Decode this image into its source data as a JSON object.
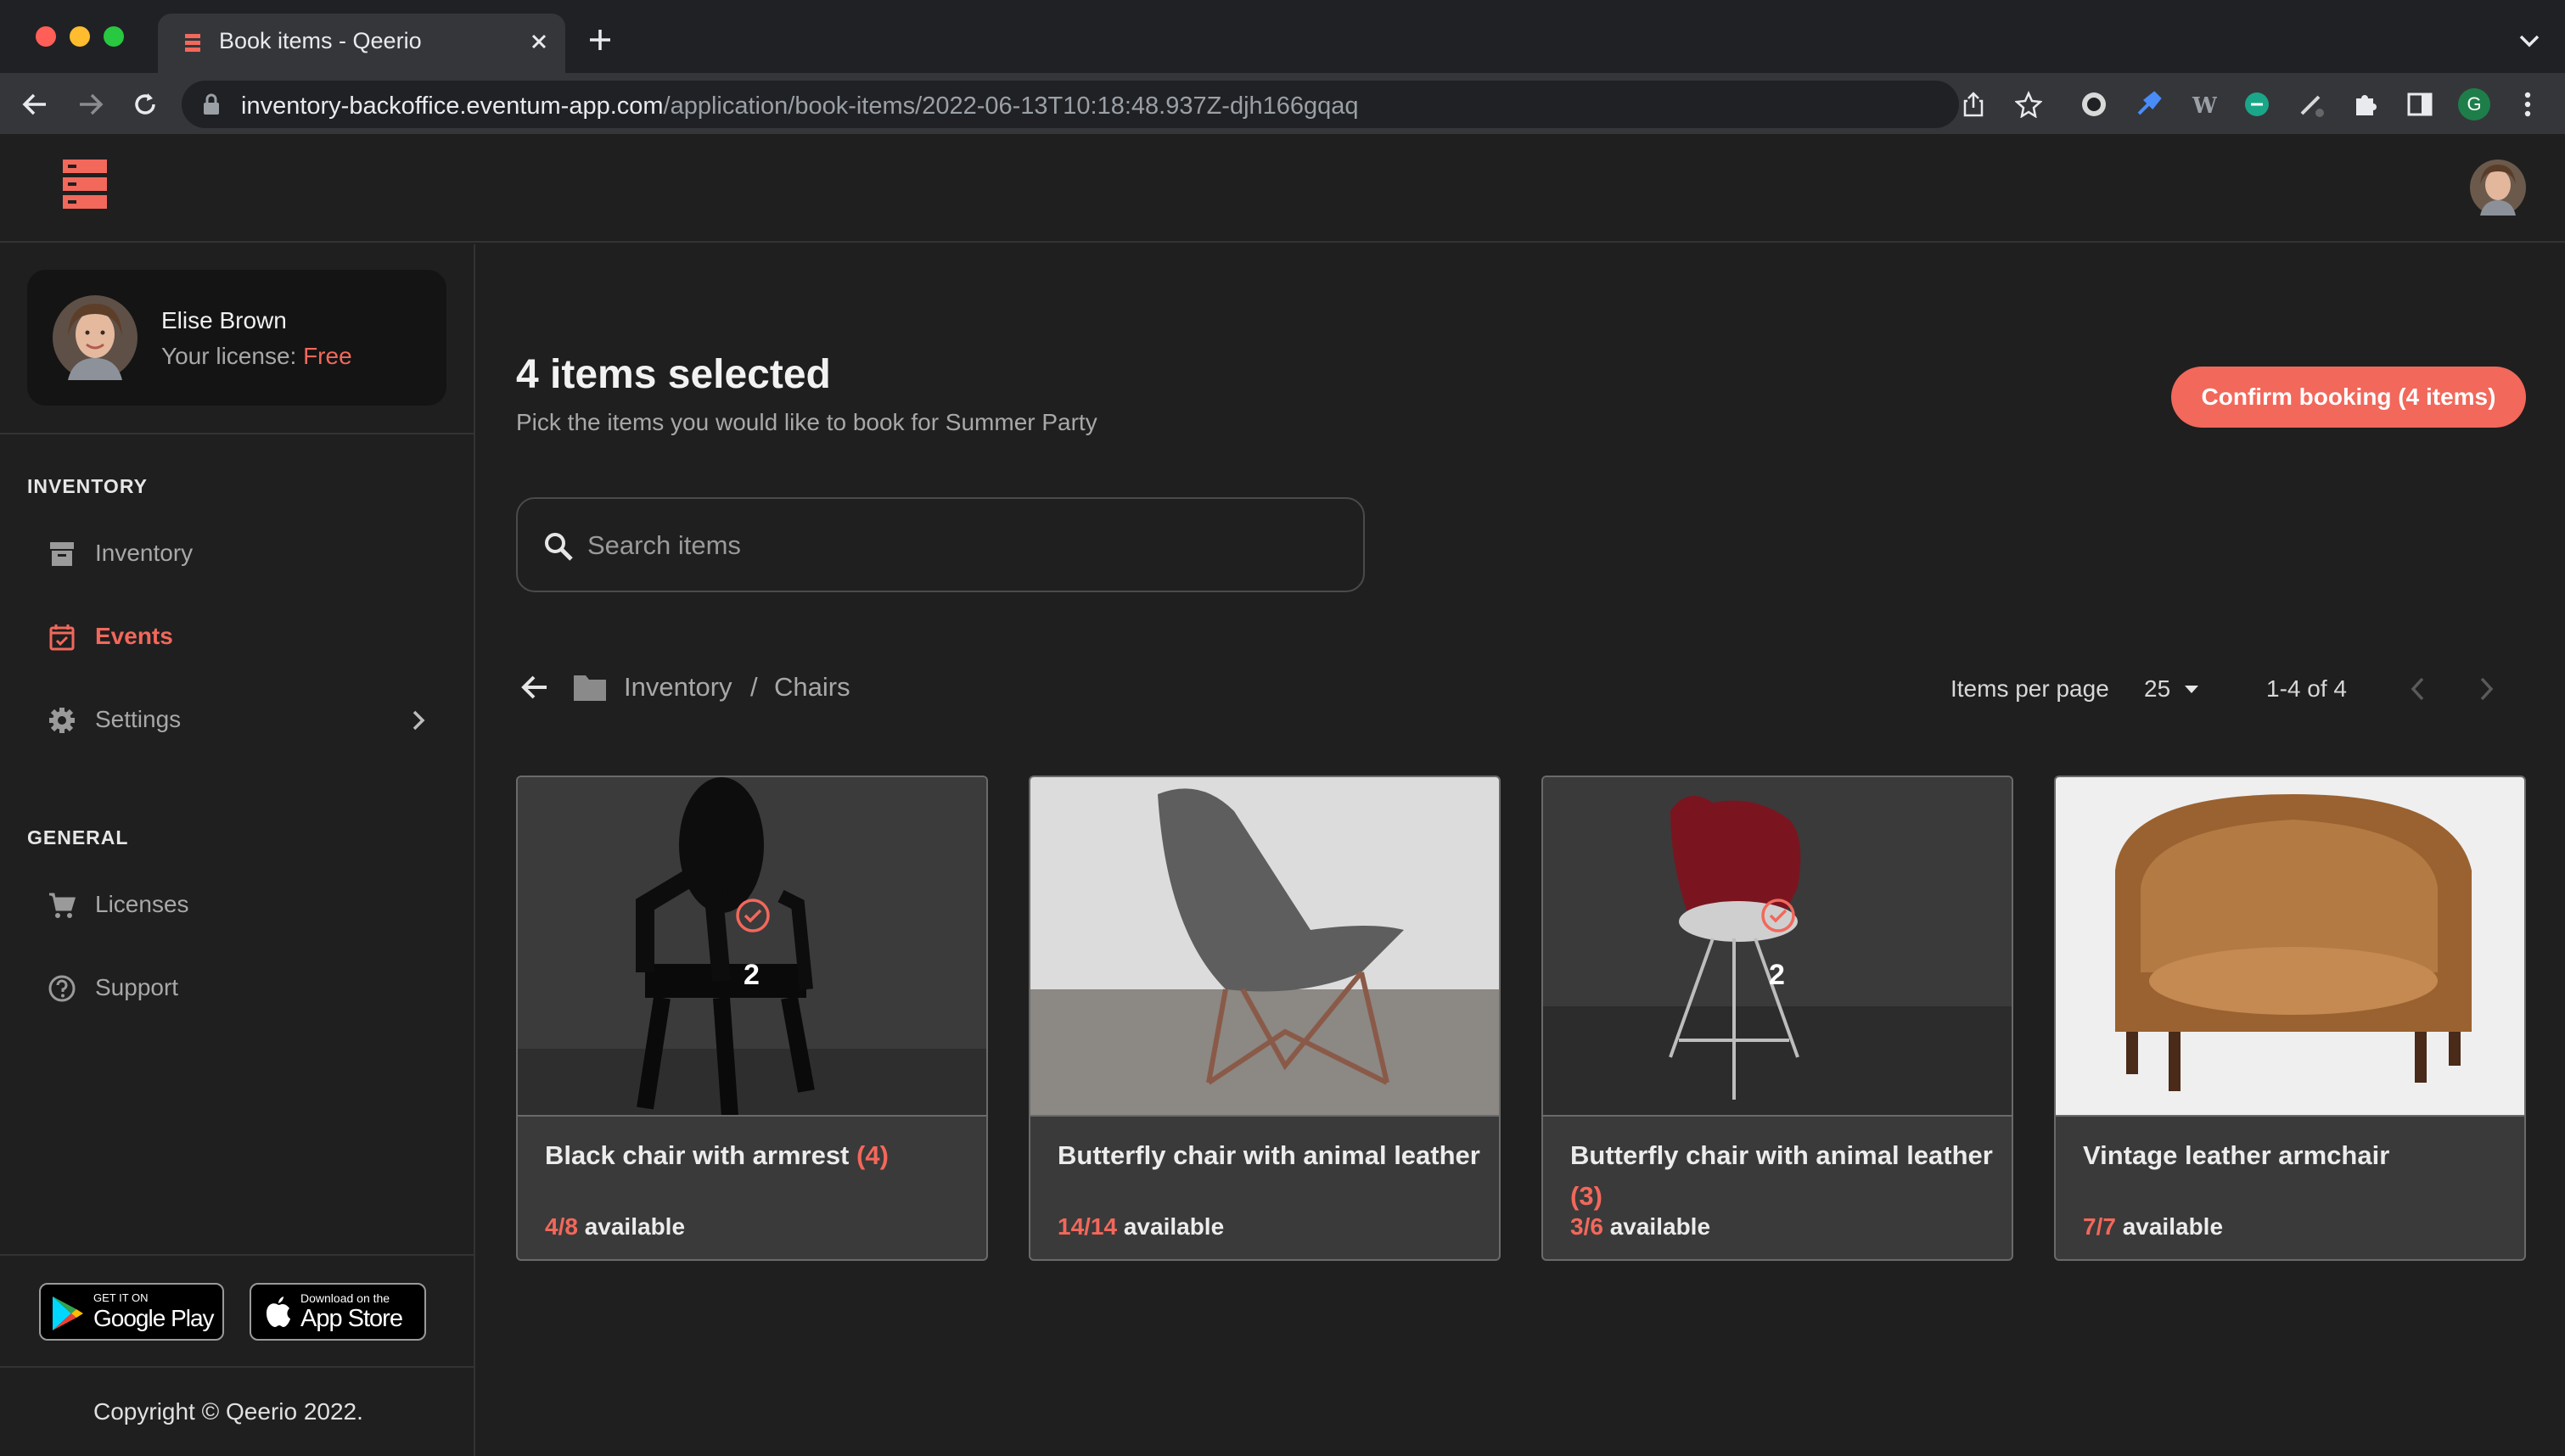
{
  "browser": {
    "tab_title": "Book items - Qeerio",
    "url_host": "inventory-backoffice.eventum-app.com",
    "url_path": "/application/book-items/2022-06-13T10:18:48.937Z-djh166gqaq",
    "profile_initial": "G"
  },
  "user": {
    "name": "Elise Brown",
    "license_label": "Your license:",
    "license_value": "Free"
  },
  "sidebar": {
    "inventory_section": "INVENTORY",
    "general_section": "GENERAL",
    "items": [
      {
        "label": "Inventory",
        "icon": "archive-icon",
        "active": false
      },
      {
        "label": "Events",
        "icon": "calendar-check-icon",
        "active": true
      },
      {
        "label": "Settings",
        "icon": "gear-icon",
        "active": false
      },
      {
        "label": "Licenses",
        "icon": "cart-icon",
        "active": false
      },
      {
        "label": "Support",
        "icon": "help-circle-icon",
        "active": false
      }
    ],
    "google_play": {
      "small": "GET IT ON",
      "big": "Google Play"
    },
    "app_store": {
      "small": "Download on the",
      "big": "App Store"
    },
    "copyright": "Copyright © Qeerio 2022."
  },
  "main": {
    "title": "4 items selected",
    "subtitle": "Pick the items you would like to book for Summer Party",
    "confirm_button": "Confirm booking (4 items)",
    "search_placeholder": "Search items",
    "breadcrumb": [
      "Inventory",
      "/",
      "Chairs"
    ],
    "items_per_page_label": "Items per page",
    "items_per_page_value": "25",
    "range_text": "1-4 of 4"
  },
  "cards": [
    {
      "name": "Black chair with armrest",
      "qty": "(4)",
      "avail_nums": "4/8",
      "avail_label": "available",
      "overlay_count": "2",
      "selected": true
    },
    {
      "name": "Butterfly chair with animal leather",
      "qty": "",
      "avail_nums": "14/14",
      "avail_label": "available",
      "overlay_count": "",
      "selected": false
    },
    {
      "name": "Butterfly chair with animal leather",
      "qty": "(3)",
      "avail_nums": "3/6",
      "avail_label": "available",
      "overlay_count": "2",
      "selected": true
    },
    {
      "name": "Vintage leather armchair",
      "qty": "",
      "avail_nums": "7/7",
      "avail_label": "available",
      "overlay_count": "",
      "selected": false
    }
  ],
  "colors": {
    "accent": "#f2685b",
    "background": "#1f1f1f",
    "card": "#3a3a3a"
  }
}
